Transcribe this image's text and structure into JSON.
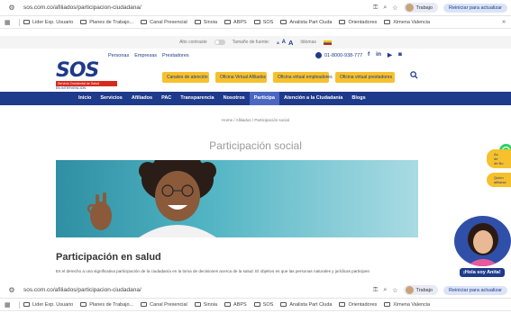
{
  "browser": {
    "url": "sos.com.co/afiliados/participacion-ciudadana/",
    "profile_label": "Trabajo",
    "restart_label": "Reiniciar para actualizar",
    "bookmarks": [
      "Lider Exp. Usuario",
      "Planes de Trabajo...",
      "Canal Presencial",
      "Sinoia",
      "ABPS",
      "SOS",
      "Analista Part Ciuda",
      "Orientadores",
      "Ximena Valencia"
    ],
    "more": "»"
  },
  "access_bar": {
    "contrast_label": "Alto contraste",
    "font_size_label": "Tamaño de fuente:",
    "font_sizes": [
      "a",
      "A",
      "A"
    ],
    "language_label": "Idiomas"
  },
  "top_links": [
    "Personas",
    "Empresas",
    "Prestadores"
  ],
  "phone": "01-8000-938-777",
  "social": [
    "f",
    "in",
    "yt",
    "ig"
  ],
  "logo": {
    "text": "SOS",
    "tagline": "Servicio Occidental de Salud",
    "sub": "EN INTERVENCIÓN"
  },
  "header_buttons": [
    "Canales de atención",
    "Oficina Virtual Afiliados",
    "Oficina virtual empleadores",
    "Oficina virtual prestadores"
  ],
  "nav": [
    "Inicio",
    "Servicios",
    "Afiliados",
    "PAC",
    "Transparencia",
    "Nosotros",
    "Participa",
    "Atención a la Ciudadanía",
    "Blogs"
  ],
  "breadcrumb": "Home  /  Afiliados  /  Participación social",
  "page_title": "Participación social",
  "section_title": "Participación en salud",
  "paragraph": "Es el derecho a una significativa participación de la ciudadanía en la toma de decisiones acerca de la salud. El objetivo es que las personas naturales y jurídicas participen",
  "widgets": {
    "pill1": "Ac\nde\nde Bo",
    "pill2": "Quien\nafiliarse",
    "chatbot": "¡Hola soy Anita!"
  }
}
